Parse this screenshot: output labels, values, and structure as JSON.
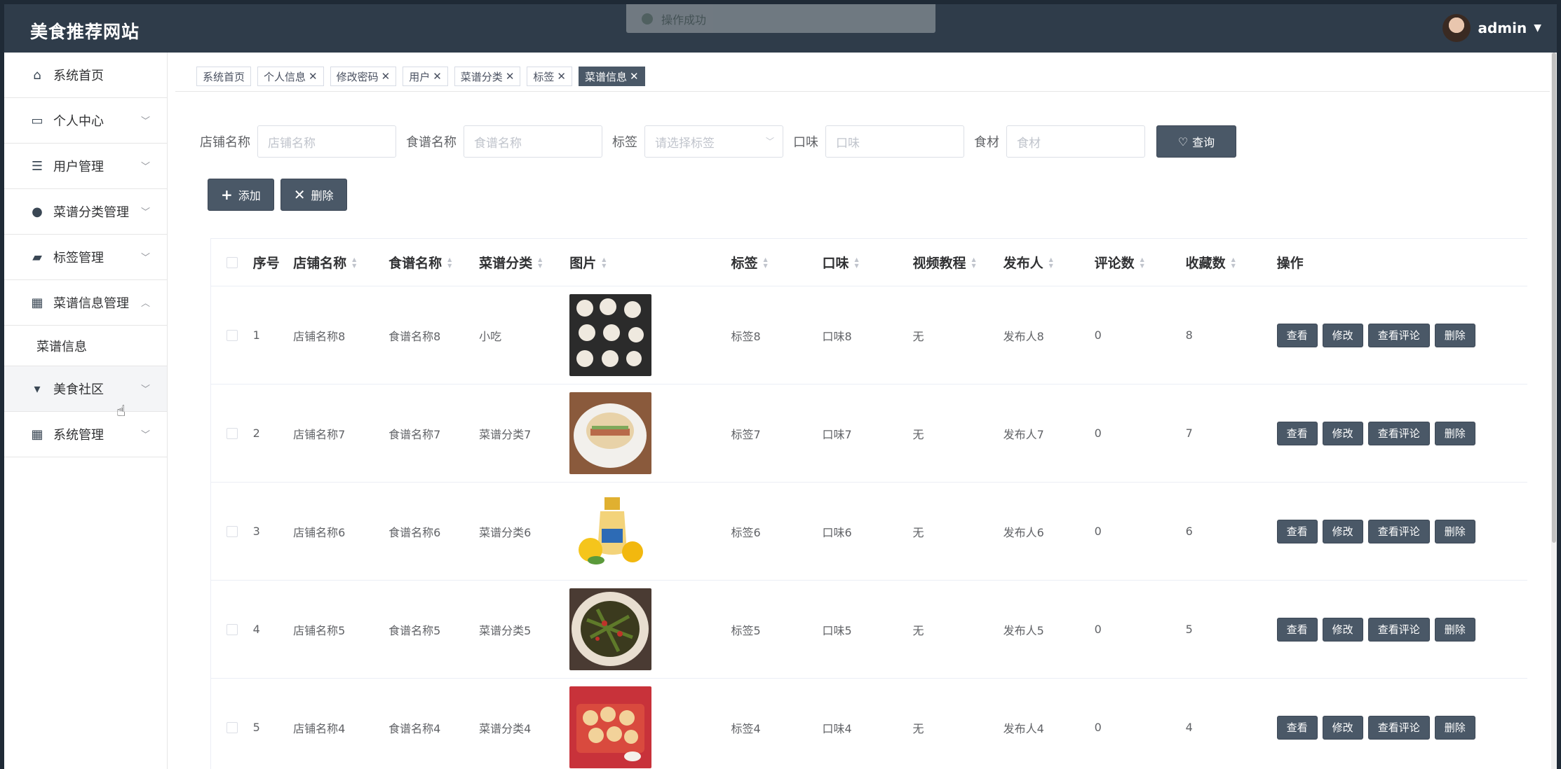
{
  "header": {
    "site_title": "美食推荐网站",
    "toast": "操作成功",
    "username": "admin"
  },
  "sidebar": {
    "items": [
      {
        "label": "系统首页",
        "icon": "home-icon"
      },
      {
        "label": "个人中心",
        "icon": "card-icon"
      },
      {
        "label": "用户管理",
        "icon": "sliders-icon"
      },
      {
        "label": "菜谱分类管理",
        "icon": "user-icon"
      },
      {
        "label": "标签管理",
        "icon": "wallet-icon"
      },
      {
        "label": "菜谱信息管理",
        "icon": "grid-icon"
      },
      {
        "label": "美食社区",
        "icon": "cutlery-icon"
      },
      {
        "label": "系统管理",
        "icon": "grid-icon"
      }
    ],
    "submenu": "菜谱信息"
  },
  "tabs": [
    {
      "label": "系统首页",
      "closable": false
    },
    {
      "label": "个人信息",
      "closable": true
    },
    {
      "label": "修改密码",
      "closable": true
    },
    {
      "label": "用户",
      "closable": true
    },
    {
      "label": "菜谱分类",
      "closable": true
    },
    {
      "label": "标签",
      "closable": true
    },
    {
      "label": "菜谱信息",
      "closable": true,
      "active": true
    }
  ],
  "search": {
    "shop_label": "店铺名称",
    "shop_placeholder": "店铺名称",
    "food_label": "食谱名称",
    "food_placeholder": "食谱名称",
    "tag_label": "标签",
    "tag_placeholder": "请选择标签",
    "taste_label": "口味",
    "taste_placeholder": "口味",
    "ingredient_label": "食材",
    "ingredient_placeholder": "食材",
    "query_label": "查询"
  },
  "actions": {
    "add_label": "添加",
    "delete_label": "删除"
  },
  "table": {
    "headers": {
      "no": "序号",
      "shop": "店铺名称",
      "food": "食谱名称",
      "category": "菜谱分类",
      "image": "图片",
      "tag": "标签",
      "taste": "口味",
      "video": "视频教程",
      "publisher": "发布人",
      "comments": "评论数",
      "favorites": "收藏数",
      "ops": "操作"
    },
    "ops": {
      "view": "查看",
      "edit": "修改",
      "view_comments": "查看评论",
      "delete": "删除"
    },
    "rows": [
      {
        "no": "1",
        "shop": "店铺名称8",
        "food": "食谱名称8",
        "category": "小吃",
        "tag": "标签8",
        "taste": "口味8",
        "video": "无",
        "publisher": "发布人8",
        "comments": "0",
        "favorites": "8",
        "image": "dumplings"
      },
      {
        "no": "2",
        "shop": "店铺名称7",
        "food": "食谱名称7",
        "category": "菜谱分类7",
        "tag": "标签7",
        "taste": "口味7",
        "video": "无",
        "publisher": "发布人7",
        "comments": "0",
        "favorites": "7",
        "image": "burger-plate"
      },
      {
        "no": "3",
        "shop": "店铺名称6",
        "food": "食谱名称6",
        "category": "菜谱分类6",
        "tag": "标签6",
        "taste": "口味6",
        "video": "无",
        "publisher": "发布人6",
        "comments": "0",
        "favorites": "6",
        "image": "lemon-drink"
      },
      {
        "no": "4",
        "shop": "店铺名称5",
        "food": "食谱名称5",
        "category": "菜谱分类5",
        "tag": "标签5",
        "taste": "口味5",
        "video": "无",
        "publisher": "发布人5",
        "comments": "0",
        "favorites": "5",
        "image": "stir-fry"
      },
      {
        "no": "5",
        "shop": "店铺名称4",
        "food": "食谱名称4",
        "category": "菜谱分类4",
        "tag": "标签4",
        "taste": "口味4",
        "video": "无",
        "publisher": "发布人4",
        "comments": "0",
        "favorites": "4",
        "image": "cookies"
      }
    ]
  }
}
